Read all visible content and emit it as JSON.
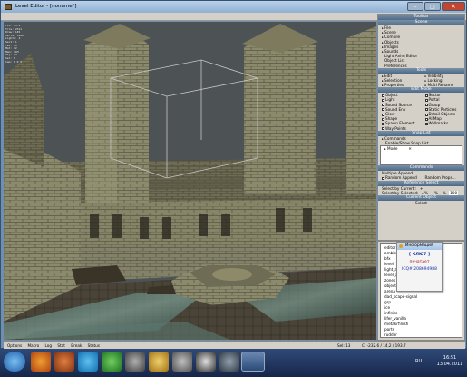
{
  "window": {
    "title": "Level Editor - [noname*]",
    "min": "–",
    "max": "□",
    "close": "✕"
  },
  "viewport_toolbar": [
    "+",
    "↔",
    "⟲",
    "✥",
    "⬚",
    "⬡",
    "⊕",
    "↕",
    "L",
    "⊞",
    "☰",
    "↶",
    "↷",
    "▣",
    "■",
    "T",
    "L",
    "B",
    "T",
    "X"
  ],
  "fps_overlay": "FPS: 53.2\nTris: 2311\nDraw: 145\nVerts: 3940\nLights: 4\nSect: 1\nTex: 36\nMat: 12\nMem: 41M\nObj: 12\nSel: 0\nCam: 0 0 0",
  "toolbox": {
    "title": "Toolbar",
    "scene_hdr": "Scene",
    "scene_items": [
      {
        "label": "File",
        "arrow": "▸"
      },
      {
        "label": "Scene",
        "arrow": "▸"
      },
      {
        "label": "Compile",
        "arrow": "▸"
      },
      {
        "label": "Objects",
        "arrow": "▸"
      },
      {
        "label": "Images",
        "arrow": "▸"
      },
      {
        "label": "Sounds",
        "arrow": "▸"
      },
      {
        "label": "Light Anim Editor",
        "arrow": ""
      },
      {
        "label": "Object List",
        "arrow": ""
      },
      {
        "label": "Preferences",
        "arrow": ""
      }
    ],
    "tools_hdr": "Tools",
    "tools": [
      [
        "Edit",
        "Visibility"
      ],
      [
        "Selection",
        "Locking"
      ],
      [
        "Properties",
        "Multi Rename"
      ]
    ],
    "editmode_hdr": "Edit Mode",
    "editmode": [
      [
        "Object",
        "Sector"
      ],
      [
        "Light",
        "Portal"
      ],
      [
        "Sound Source",
        "Group"
      ],
      [
        "Sound Env",
        "Static Particles"
      ],
      [
        "Glow",
        "Detail Objects"
      ],
      [
        "Shape",
        "AI Map"
      ],
      [
        "Spawn Element",
        "Wallmarks"
      ],
      [
        "Way Points",
        ""
      ]
    ],
    "snap_hdr": "Snap List",
    "snap_items": [
      "Commands",
      "Enable/Show Snap List"
    ],
    "snap_mode": "Mode",
    "commands_hdr": "Commands",
    "multiple_append": "Multiple Append",
    "random_append": "Random Append",
    "random_props": "Random Props...",
    "ref_hdr": "Reference Select",
    "select_current": "Select by Current:",
    "select_selected": "Select by Selected:",
    "pct_vals": [
      "=%",
      "+%",
      "-%"
    ],
    "pct_num": "100",
    "current_hdr": "Current Object",
    "select_btn": "Select"
  },
  "objects_list": [
    "editor",
    "ambient",
    "bfx",
    "level",
    "light_ai",
    "level_ai",
    "zones",
    "objects",
    "arena",
    "dad_scape-signal",
    "grp",
    "ice",
    "infinite",
    "lifer_vanilla",
    "metakrfinish",
    "ports",
    "rudder"
  ],
  "notification": {
    "title": "Информация",
    "line1": "[ КЛЮ7 ]",
    "line2": "печатает",
    "line3": "ICQ# 208694988"
  },
  "status": {
    "options": "Options",
    "macro": "Macro",
    "log": "Log",
    "stat": "Stat",
    "break": "Break",
    "status": "Status",
    "sel": "Sel: 13",
    "coords": "C: -232.6 / 14.2 / 193.7"
  },
  "taskbar": {
    "lang": "RU",
    "time": "16:51",
    "date": "13.04.2011"
  }
}
